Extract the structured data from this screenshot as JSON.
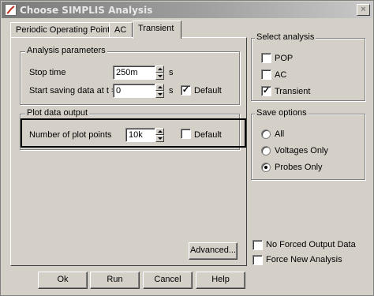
{
  "window": {
    "title": "Choose SIMPLIS Analysis"
  },
  "tabs": [
    {
      "label": "Periodic Operating Point"
    },
    {
      "label": "AC"
    },
    {
      "label": "Transient"
    }
  ],
  "analysis_parameters": {
    "title": "Analysis parameters",
    "stop_time": {
      "label": "Stop time",
      "value": "250m",
      "unit": "s"
    },
    "start_saving": {
      "label": "Start saving data at t =",
      "value": "0",
      "unit": "s",
      "default_label": "Default",
      "default_checked": true
    }
  },
  "plot_data_output": {
    "title": "Plot data output",
    "num_points": {
      "label": "Number of plot points",
      "value": "10k",
      "default_label": "Default",
      "default_checked": false
    }
  },
  "advanced_button": "Advanced...",
  "select_analysis": {
    "title": "Select analysis",
    "items": [
      {
        "label": "POP",
        "checked": false
      },
      {
        "label": "AC",
        "checked": false
      },
      {
        "label": "Transient",
        "checked": true
      }
    ]
  },
  "save_options": {
    "title": "Save options",
    "items": [
      {
        "label": "All",
        "selected": false
      },
      {
        "label": "Voltages Only",
        "selected": false
      },
      {
        "label": "Probes Only",
        "selected": true
      }
    ]
  },
  "no_forced_output": {
    "label": "No Forced Output Data",
    "checked": false
  },
  "force_new_analysis": {
    "label": "Force New Analysis",
    "checked": false
  },
  "buttons": {
    "ok": "Ok",
    "run": "Run",
    "cancel": "Cancel",
    "help": "Help"
  },
  "glyphs": {
    "check": "✓",
    "close": "×"
  }
}
